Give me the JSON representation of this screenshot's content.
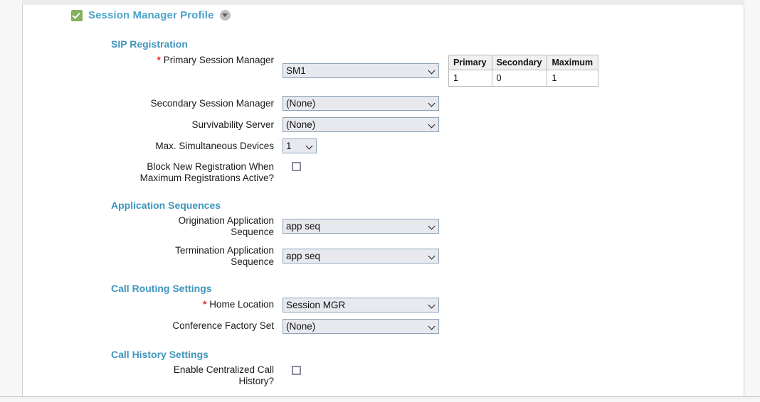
{
  "profile": {
    "title": "Session Manager Profile",
    "enabled_icon": "green-check-icon",
    "collapse_icon": "chevron-down-circle-icon"
  },
  "sections": {
    "sip_registration": {
      "heading": "SIP Registration",
      "fields": {
        "primary_session_manager": {
          "label": "Primary Session Manager",
          "required": true,
          "value": "SM1"
        },
        "secondary_session_manager": {
          "label": "Secondary Session Manager",
          "required": false,
          "value": "(None)"
        },
        "survivability_server": {
          "label": "Survivability Server",
          "required": false,
          "value": "(None)"
        },
        "max_simultaneous_devices": {
          "label": "Max. Simultaneous Devices",
          "required": false,
          "value": "1"
        },
        "block_new_registration": {
          "label_line1": "Block New Registration When",
          "label_line2": "Maximum Registrations Active?",
          "checked": false
        }
      },
      "registration_table": {
        "headers": [
          "Primary",
          "Secondary",
          "Maximum"
        ],
        "rows": [
          [
            "1",
            "0",
            "1"
          ]
        ]
      }
    },
    "application_sequences": {
      "heading": "Application Sequences",
      "fields": {
        "origination_application_sequence": {
          "label_line1": "Origination Application",
          "label_line2": "Sequence",
          "value": "app seq"
        },
        "termination_application_sequence": {
          "label_line1": "Termination Application",
          "label_line2": "Sequence",
          "value": "app seq"
        }
      }
    },
    "call_routing_settings": {
      "heading": "Call Routing Settings",
      "fields": {
        "home_location": {
          "label": "Home Location",
          "required": true,
          "value": "Session MGR"
        },
        "conference_factory_set": {
          "label": "Conference Factory Set",
          "required": false,
          "value": "(None)"
        }
      }
    },
    "call_history_settings": {
      "heading": "Call History Settings",
      "fields": {
        "enable_centralized_call_history": {
          "label_line1": "Enable Centralized Call",
          "label_line2": "History?",
          "checked": false
        }
      }
    }
  },
  "colors": {
    "heading": "#3f95bd",
    "title": "#4ca3c9",
    "required_marker": "#ee2222",
    "checkbox_enabled": "#86b05e",
    "select_background": "#e7e9ef",
    "select_border": "#8fa3b8"
  }
}
